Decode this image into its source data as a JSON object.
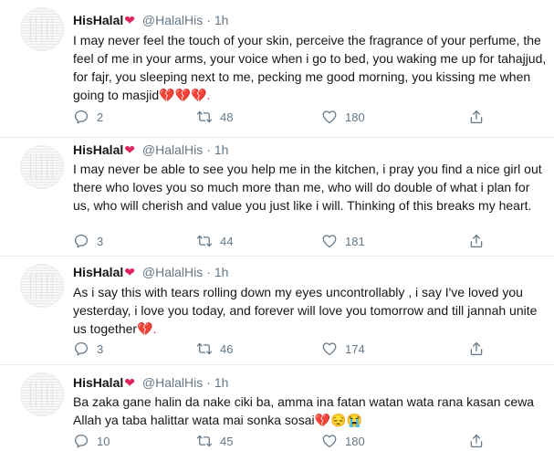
{
  "tweets": [
    {
      "name": "HisHalal",
      "name_emoji": "❤",
      "handle": "@HalalHis",
      "dot": "·",
      "time": "1h",
      "text": "I may never feel the touch of your skin, perceive the fragrance of your perfume, the feel of me in your arms, your voice when i go to bed, you waking me up for tahajjud, for fajr, you sleeping next to me, pecking me good morning, you kissing me when going to masjid",
      "text_emoji": "💔💔💔.",
      "replies": "2",
      "retweets": "48",
      "likes": "180"
    },
    {
      "name": "HisHalal",
      "name_emoji": "❤",
      "handle": "@HalalHis",
      "dot": "·",
      "time": "1h",
      "text": "I may never be able to see you help me in the kitchen, i pray you find a nice girl out there who loves you so much more than me, who will do double of what i plan for us, who will cherish and value you just like i will. Thinking of this breaks my heart.",
      "text_emoji": "",
      "replies": "3",
      "retweets": "44",
      "likes": "181"
    },
    {
      "name": "HisHalal",
      "name_emoji": "❤",
      "handle": "@HalalHis",
      "dot": "·",
      "time": "1h",
      "text": "As i say this with tears rolling down my eyes uncontrollably , i say I've loved you yesterday, i love you today, and forever will love you tomorrow and till jannah unite us together",
      "text_emoji": "💔.",
      "replies": "3",
      "retweets": "46",
      "likes": "174"
    },
    {
      "name": "HisHalal",
      "name_emoji": "❤",
      "handle": "@HalalHis",
      "dot": "·",
      "time": "1h",
      "text": "Ba zaka gane halin da nake ciki ba, amma ina fatan watan wata rana kasan cewa Allah ya taba halittar wata mai sonka sosai",
      "text_emoji": "💔😔😭",
      "replies": "10",
      "retweets": "45",
      "likes": "180"
    }
  ]
}
